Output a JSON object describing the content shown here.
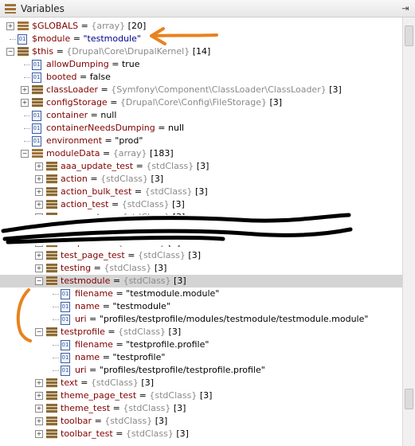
{
  "window": {
    "title": "Variables",
    "pin_icon": "pin-icon"
  },
  "rows": [
    {
      "name": "$GLOBALS",
      "type": "{array}",
      "count": "[20]",
      "icon": "array",
      "exp": "+",
      "indent": 0
    },
    {
      "name": "$module",
      "value": "\"testmodule\"",
      "icon": "value",
      "exp": "",
      "indent": 0
    },
    {
      "name": "$this",
      "type": "{Drupal\\Core\\DrupalKernel}",
      "count": "[14]",
      "icon": "object",
      "exp": "-",
      "indent": 0
    },
    {
      "name": "allowDumping",
      "value": "true",
      "icon": "value",
      "exp": "",
      "indent": 1
    },
    {
      "name": "booted",
      "value": "false",
      "icon": "value",
      "exp": "",
      "indent": 1
    },
    {
      "name": "classLoader",
      "type": "{Symfony\\Component\\ClassLoader\\ClassLoader}",
      "count": "[3]",
      "icon": "object",
      "exp": "+",
      "indent": 1
    },
    {
      "name": "configStorage",
      "type": "{Drupal\\Core\\Config\\FileStorage}",
      "count": "[3]",
      "icon": "object",
      "exp": "+",
      "indent": 1
    },
    {
      "name": "container",
      "value": "null",
      "icon": "value",
      "exp": "",
      "indent": 1
    },
    {
      "name": "containerNeedsDumping",
      "value": "null",
      "icon": "value",
      "exp": "",
      "indent": 1
    },
    {
      "name": "environment",
      "value": "\"prod\"",
      "icon": "value",
      "exp": "",
      "indent": 1
    },
    {
      "name": "moduleData",
      "type": "{array}",
      "count": "[183]",
      "icon": "array",
      "exp": "-",
      "indent": 1
    },
    {
      "name": "aaa_update_test",
      "type": "{stdClass}",
      "count": "[3]",
      "icon": "object",
      "exp": "+",
      "indent": 2
    },
    {
      "name": "action",
      "type": "{stdClass}",
      "count": "[3]",
      "icon": "object",
      "exp": "+",
      "indent": 2
    },
    {
      "name": "action_bulk_test",
      "type": "{stdClass}",
      "count": "[3]",
      "icon": "object",
      "exp": "+",
      "indent": 2
    },
    {
      "name": "action_test",
      "type": "{stdClass}",
      "count": "[3]",
      "icon": "object",
      "exp": "+",
      "indent": 2
    },
    {
      "name": "aggregator",
      "type": "{stdClass}",
      "count": "[3]",
      "icon": "object",
      "exp": "+",
      "indent": 2
    },
    {
      "name": "taxonomy_test_views",
      "type": "{stdClass}",
      "count": "[3]",
      "icon": "object",
      "exp": "+",
      "indent": 2
    },
    {
      "name": "telephone",
      "type": "{stdClass}",
      "count": "[3]",
      "icon": "object",
      "exp": "+",
      "indent": 2
    },
    {
      "name": "test_page_test",
      "type": "{stdClass}",
      "count": "[3]",
      "icon": "object",
      "exp": "+",
      "indent": 2
    },
    {
      "name": "testing",
      "type": "{stdClass}",
      "count": "[3]",
      "icon": "object",
      "exp": "+",
      "indent": 2
    },
    {
      "name": "testmodule",
      "type": "{stdClass}",
      "count": "[3]",
      "icon": "object",
      "exp": "-",
      "indent": 2,
      "selected": true
    },
    {
      "name": "filename",
      "value": "\"testmodule.module\"",
      "icon": "value",
      "exp": "",
      "indent": 3
    },
    {
      "name": "name",
      "value": "\"testmodule\"",
      "icon": "value",
      "exp": "",
      "indent": 3
    },
    {
      "name": "uri",
      "value": "\"profiles/testprofile/modules/testmodule/testmodule.module\"",
      "icon": "value",
      "exp": "",
      "indent": 3
    },
    {
      "name": "testprofile",
      "type": "{stdClass}",
      "count": "[3]",
      "icon": "object",
      "exp": "-",
      "indent": 2
    },
    {
      "name": "filename",
      "value": "\"testprofile.profile\"",
      "icon": "value",
      "exp": "",
      "indent": 3
    },
    {
      "name": "name",
      "value": "\"testprofile\"",
      "icon": "value",
      "exp": "",
      "indent": 3
    },
    {
      "name": "uri",
      "value": "\"profiles/testprofile/testprofile.profile\"",
      "icon": "value",
      "exp": "",
      "indent": 3
    },
    {
      "name": "text",
      "type": "{stdClass}",
      "count": "[3]",
      "icon": "object",
      "exp": "+",
      "indent": 2
    },
    {
      "name": "theme_page_test",
      "type": "{stdClass}",
      "count": "[3]",
      "icon": "object",
      "exp": "+",
      "indent": 2
    },
    {
      "name": "theme_test",
      "type": "{stdClass}",
      "count": "[3]",
      "icon": "object",
      "exp": "+",
      "indent": 2
    },
    {
      "name": "toolbar",
      "type": "{stdClass}",
      "count": "[3]",
      "icon": "object",
      "exp": "+",
      "indent": 2
    },
    {
      "name": "toolbar_test",
      "type": "{stdClass}",
      "count": "[3]",
      "icon": "object",
      "exp": "+",
      "indent": 2
    }
  ],
  "annotation_colors": {
    "arrow": "#e8821e",
    "bracket": "#e8821e",
    "scribble": "#000000"
  },
  "colors": {
    "selection": "#d4d4d4",
    "name": "#800000",
    "type": "#8a8a8a",
    "value": "#00008b"
  }
}
